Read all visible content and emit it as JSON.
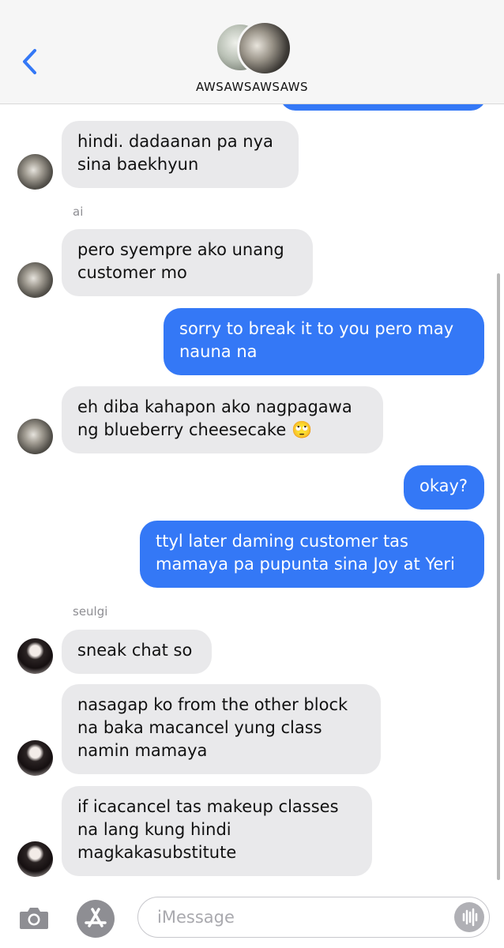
{
  "header": {
    "group_name": "AWSAWSAWSAWS",
    "back_icon": "chevron-left-icon"
  },
  "messages": [
    {
      "id": "m1",
      "side": "in",
      "text": "hindi. dadaanan pa nya\nsina baekhyun"
    },
    {
      "id": "m2",
      "side": "in",
      "sender": "ai",
      "text": "pero syempre ako unang\ncustomer mo"
    },
    {
      "id": "m3",
      "side": "out",
      "text": "sorry to break it to you pero may\nnauna na"
    },
    {
      "id": "m4",
      "side": "in",
      "text": "eh diba kahapon ako nagpagawa\nng blueberry cheesecake 🙄"
    },
    {
      "id": "m5",
      "side": "out",
      "text": "okay?"
    },
    {
      "id": "m6",
      "side": "out",
      "text": "ttyl later daming customer tas\nmamaya pa pupunta sina Joy at Yeri"
    },
    {
      "id": "m7",
      "side": "in",
      "sender": "seulgi",
      "text": "sneak chat so"
    },
    {
      "id": "m8",
      "side": "in",
      "text": "nasagap ko from the other block\nna baka macancel yung class\nnamin mamaya"
    },
    {
      "id": "m9",
      "side": "in",
      "text": "if icacancel tas makeup classes\nna lang kung hindi\nmagkakasubstitute"
    }
  ],
  "senders": {
    "ai": "ai",
    "seulgi": "seulgi"
  },
  "composer": {
    "placeholder": "iMessage",
    "camera_icon": "camera-icon",
    "apps_icon": "app-store-icon",
    "audio_icon": "audio-waveform-icon"
  },
  "colors": {
    "outgoing": "#3478f6",
    "incoming": "#e9e9eb",
    "accent": "#3478f6"
  }
}
